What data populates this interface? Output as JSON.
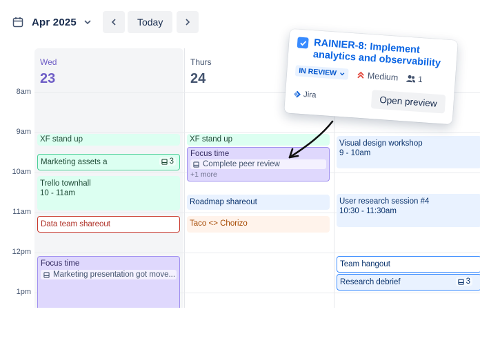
{
  "toolbar": {
    "month_label": "Apr 2025",
    "today_label": "Today",
    "icons": [
      "calendar-icon",
      "chevron-down-icon",
      "chevron-left-icon",
      "chevron-right-icon"
    ]
  },
  "time_labels": [
    "8am",
    "9am",
    "10am",
    "11am",
    "12pm",
    "1pm"
  ],
  "days": [
    {
      "name": "Wed",
      "number": "23",
      "highlight_color": "#6e5dc6"
    },
    {
      "name": "Thurs",
      "number": "24"
    }
  ],
  "events": {
    "wed": {
      "xf_standup": "XF stand up",
      "marketing_assets": "Marketing assets a",
      "marketing_assets_count": "3",
      "trello_townhall": "Trello townhall",
      "trello_townhall_time": "10 - 11am",
      "data_team": "Data team shareout",
      "focus_time": "Focus time",
      "focus_task": "Marketing presentation got move..."
    },
    "thu": {
      "xf_standup": "XF stand up",
      "focus_time": "Focus time",
      "focus_task": "Complete peer review",
      "focus_more": "+1 more",
      "roadmap": "Roadmap shareout",
      "taco": "Taco <> Chorizo"
    },
    "fri": {
      "visual_design": "Visual design workshop",
      "visual_design_time": "9 - 10am",
      "user_research": "User research session #4",
      "user_research_time": "10:30 - 11:30am",
      "team_hangout": "Team hangout",
      "research_debrief": "Research debrief",
      "research_debrief_count": "3"
    }
  },
  "popup": {
    "title": "RAINIER-8: Implement analytics and observability",
    "status": "IN REVIEW",
    "priority": "Medium",
    "people_count": "1",
    "source": "Jira",
    "open_button": "Open preview"
  },
  "colors": {
    "accent": "#0c66e4",
    "purple": "#dfd8fd",
    "green": "#dcfff1",
    "blue": "#e9f2ff",
    "red": "#c9372c",
    "orange": "#fff3eb"
  }
}
